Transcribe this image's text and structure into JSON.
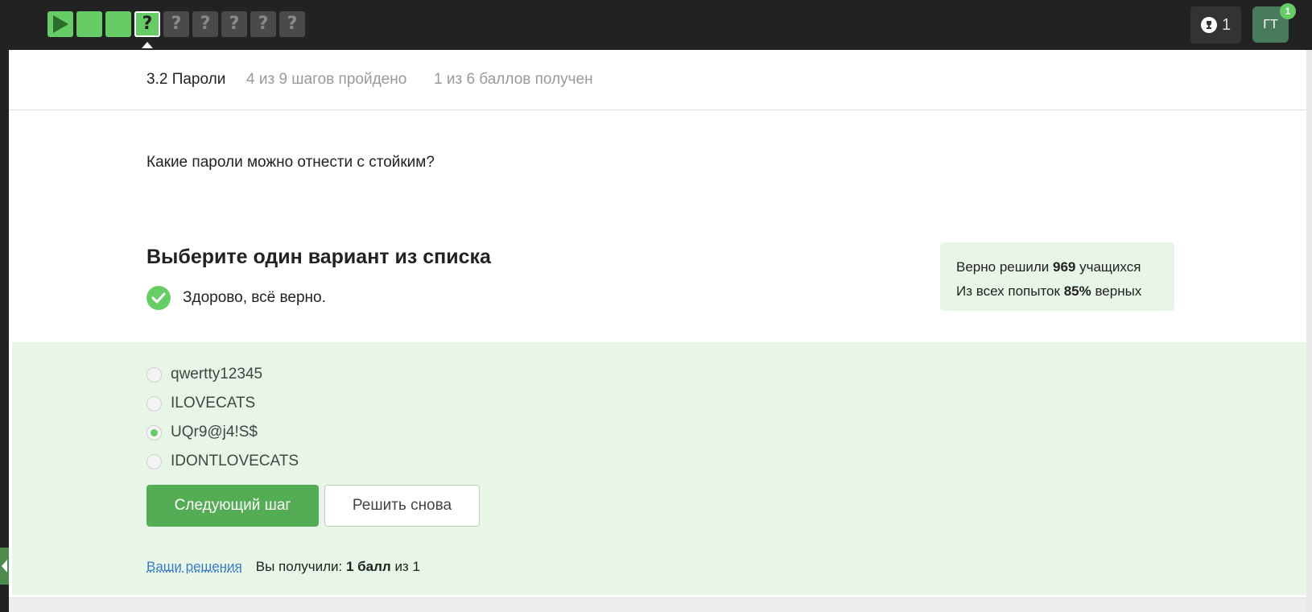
{
  "steps": [
    {
      "state": "done",
      "icon": "play-icon"
    },
    {
      "state": "done",
      "icon": ""
    },
    {
      "state": "done",
      "icon": ""
    },
    {
      "state": "current",
      "icon": "question-icon",
      "label": "?"
    },
    {
      "state": "todo",
      "icon": "question-icon",
      "label": "?"
    },
    {
      "state": "todo",
      "icon": "question-icon",
      "label": "?"
    },
    {
      "state": "todo",
      "icon": "question-icon",
      "label": "?"
    },
    {
      "state": "todo",
      "icon": "question-icon",
      "label": "?"
    },
    {
      "state": "todo",
      "icon": "question-icon",
      "label": "?"
    }
  ],
  "header": {
    "trophy_count": "1",
    "avatar_initials": "ГТ",
    "notification_count": "1"
  },
  "lesson": {
    "title": "3.2 Пароли",
    "steps_progress": "4 из 9 шагов пройдено",
    "points_progress": "1 из 6 баллов  получен"
  },
  "question": {
    "text": "Какие пароли можно отнести с стойким?",
    "instruction": "Выберите один вариант из списка",
    "result_message": "Здорово, всё верно."
  },
  "stats": {
    "solved_prefix": "Верно решили",
    "solved_count": "969",
    "solved_suffix": "учащихся",
    "attempts_prefix": "Из всех попыток",
    "attempts_percent": "85%",
    "attempts_suffix": "верных"
  },
  "options": [
    {
      "label": "qwertty12345",
      "selected": false
    },
    {
      "label": "ILOVECATS",
      "selected": false
    },
    {
      "label": "UQr9@j4!S$",
      "selected": true
    },
    {
      "label": "IDONTLOVECATS",
      "selected": false
    }
  ],
  "buttons": {
    "next": "Следующий шаг",
    "retry": "Решить снова"
  },
  "footer": {
    "solutions_link": "Ваши решения",
    "score_prefix": "Вы получили:",
    "score_value": "1 балл",
    "score_suffix": "из 1"
  },
  "colors": {
    "accent": "#66cc66",
    "button_green": "#54ad54",
    "answer_bg": "#e8f6e8",
    "topbar": "#222222"
  }
}
